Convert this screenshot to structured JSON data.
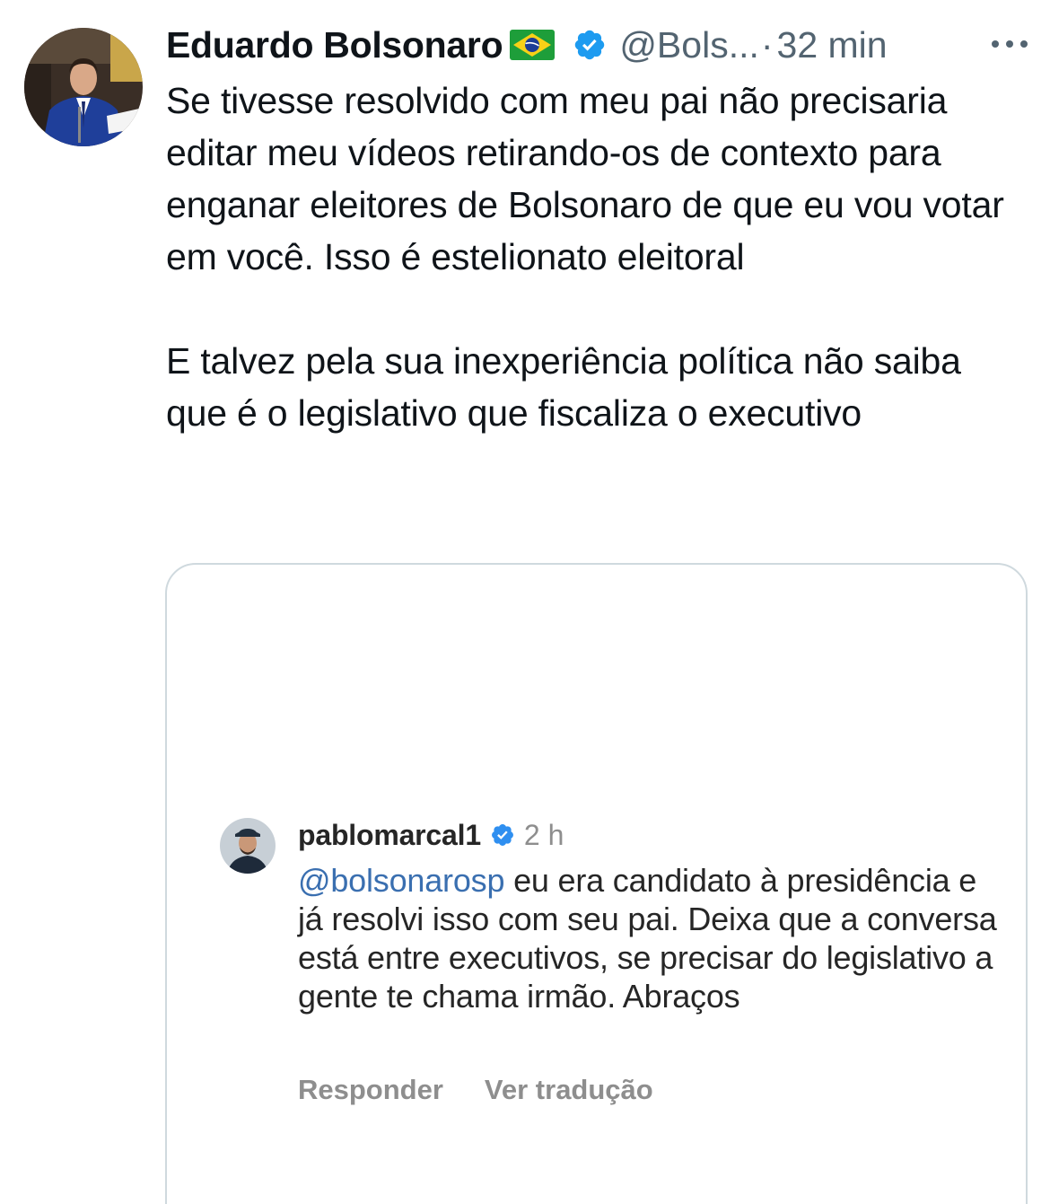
{
  "tweet": {
    "author_name": "Eduardo Bolsonaro",
    "flag_icon": "brazil-flag-icon",
    "verified_icon": "verified-badge-icon",
    "handle": "@Bols...",
    "separator": "·",
    "time": "32 min",
    "more_icon": "more-dots-icon",
    "paragraph1": "Se tivesse resolvido com meu pai não precisaria editar meu vídeos retirando-os de contexto para enganar eleitores de Bolsonaro de que eu vou votar em você. Isso é estelionato eleitoral",
    "paragraph2": "E talvez pela sua inexperiência política não saiba que é o legislativo que fiscaliza o executivo"
  },
  "media": {
    "username": "pablomarcal1",
    "verified_icon": "verified-badge-icon",
    "time": "2 h",
    "mention": "@bolsonarosp",
    "comment_text": " eu era candidato à presidência e já resolvi isso com seu pai. Deixa que a conversa está entre executivos, se precisar do legislativo a gente te chama irmão. Abraços",
    "reply_label": "Responder",
    "translate_label": "Ver tradução"
  },
  "colors": {
    "text_primary": "#0f1419",
    "text_secondary": "#536471",
    "verified_blue": "#1d9bf0",
    "ig_mention": "#3a6fb0",
    "ig_secondary": "#8e8e8e",
    "card_border": "#cfd9de"
  }
}
